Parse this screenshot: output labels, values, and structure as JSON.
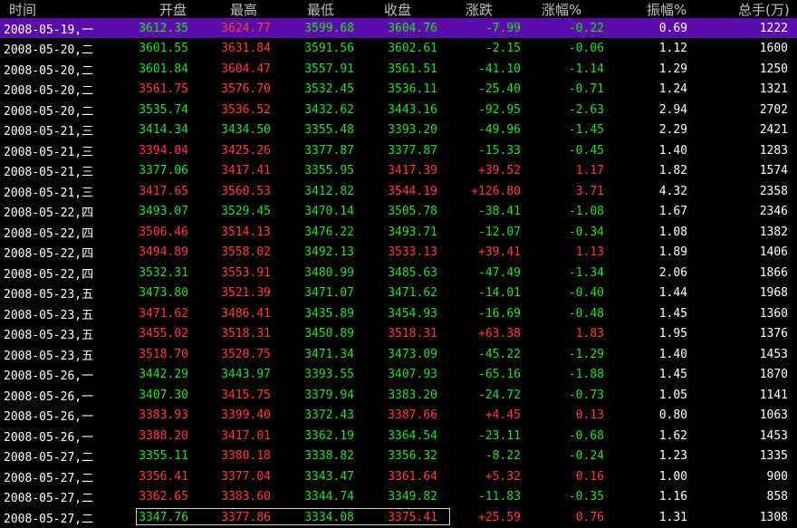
{
  "colors": {
    "up": "#ff3b3b",
    "down": "#22dd22",
    "neutral": "#ffffff",
    "header": "#c0c0c0",
    "selected_bg": "#5a0da8"
  },
  "header": [
    "时间",
    "开盘",
    "最高",
    "最低",
    "收盘",
    "涨跌",
    "涨幅%",
    "振幅%",
    "总手(万)"
  ],
  "rows": [
    {
      "time": "2008-05-19,一",
      "open": "3612.35",
      "high": "3624.77",
      "low": "3599.68",
      "close": "3604.76",
      "chg": "-7.99",
      "pct": "-0.22",
      "amp": "0.69",
      "vol": "1222",
      "c": [
        "down",
        "up",
        "down",
        "down",
        "down",
        "down",
        "neutral",
        "neutral"
      ]
    },
    {
      "time": "2008-05-20,二",
      "open": "3601.55",
      "high": "3631.84",
      "low": "3591.56",
      "close": "3602.61",
      "chg": "-2.15",
      "pct": "-0.06",
      "amp": "1.12",
      "vol": "1600",
      "c": [
        "down",
        "up",
        "down",
        "down",
        "down",
        "down",
        "neutral",
        "neutral"
      ]
    },
    {
      "time": "2008-05-20,二",
      "open": "3601.84",
      "high": "3604.47",
      "low": "3557.91",
      "close": "3561.51",
      "chg": "-41.10",
      "pct": "-1.14",
      "amp": "1.29",
      "vol": "1250",
      "c": [
        "down",
        "up",
        "down",
        "down",
        "down",
        "down",
        "neutral",
        "neutral"
      ]
    },
    {
      "time": "2008-05-20,二",
      "open": "3561.75",
      "high": "3576.70",
      "low": "3532.45",
      "close": "3536.11",
      "chg": "-25.40",
      "pct": "-0.71",
      "amp": "1.24",
      "vol": "1321",
      "c": [
        "up",
        "up",
        "down",
        "down",
        "down",
        "down",
        "neutral",
        "neutral"
      ]
    },
    {
      "time": "2008-05-20,二",
      "open": "3535.74",
      "high": "3536.52",
      "low": "3432.62",
      "close": "3443.16",
      "chg": "-92.95",
      "pct": "-2.63",
      "amp": "2.94",
      "vol": "2702",
      "c": [
        "down",
        "up",
        "down",
        "down",
        "down",
        "down",
        "neutral",
        "neutral"
      ]
    },
    {
      "time": "2008-05-21,三",
      "open": "3414.34",
      "high": "3434.50",
      "low": "3355.48",
      "close": "3393.20",
      "chg": "-49.96",
      "pct": "-1.45",
      "amp": "2.29",
      "vol": "2421",
      "c": [
        "down",
        "down",
        "down",
        "down",
        "down",
        "down",
        "neutral",
        "neutral"
      ]
    },
    {
      "time": "2008-05-21,三",
      "open": "3394.04",
      "high": "3425.26",
      "low": "3377.87",
      "close": "3377.87",
      "chg": "-15.33",
      "pct": "-0.45",
      "amp": "1.40",
      "vol": "1283",
      "c": [
        "up",
        "up",
        "down",
        "down",
        "down",
        "down",
        "neutral",
        "neutral"
      ]
    },
    {
      "time": "2008-05-21,三",
      "open": "3377.06",
      "high": "3417.41",
      "low": "3355.95",
      "close": "3417.39",
      "chg": "+39.52",
      "pct": "1.17",
      "amp": "1.82",
      "vol": "1574",
      "c": [
        "down",
        "up",
        "down",
        "up",
        "up",
        "up",
        "neutral",
        "neutral"
      ]
    },
    {
      "time": "2008-05-21,三",
      "open": "3417.65",
      "high": "3560.53",
      "low": "3412.82",
      "close": "3544.19",
      "chg": "+126.80",
      "pct": "3.71",
      "amp": "4.32",
      "vol": "2358",
      "c": [
        "up",
        "up",
        "down",
        "up",
        "up",
        "up",
        "neutral",
        "neutral"
      ]
    },
    {
      "time": "2008-05-22,四",
      "open": "3493.07",
      "high": "3529.45",
      "low": "3470.14",
      "close": "3505.78",
      "chg": "-38.41",
      "pct": "-1.08",
      "amp": "1.67",
      "vol": "2346",
      "c": [
        "down",
        "down",
        "down",
        "down",
        "down",
        "down",
        "neutral",
        "neutral"
      ]
    },
    {
      "time": "2008-05-22,四",
      "open": "3506.46",
      "high": "3514.13",
      "low": "3476.22",
      "close": "3493.71",
      "chg": "-12.07",
      "pct": "-0.34",
      "amp": "1.08",
      "vol": "1382",
      "c": [
        "up",
        "up",
        "down",
        "down",
        "down",
        "down",
        "neutral",
        "neutral"
      ]
    },
    {
      "time": "2008-05-22,四",
      "open": "3494.89",
      "high": "3558.02",
      "low": "3492.13",
      "close": "3533.13",
      "chg": "+39.41",
      "pct": "1.13",
      "amp": "1.89",
      "vol": "1406",
      "c": [
        "up",
        "up",
        "down",
        "up",
        "up",
        "up",
        "neutral",
        "neutral"
      ]
    },
    {
      "time": "2008-05-22,四",
      "open": "3532.31",
      "high": "3553.91",
      "low": "3480.99",
      "close": "3485.63",
      "chg": "-47.49",
      "pct": "-1.34",
      "amp": "2.06",
      "vol": "1866",
      "c": [
        "down",
        "up",
        "down",
        "down",
        "down",
        "down",
        "neutral",
        "neutral"
      ]
    },
    {
      "time": "2008-05-23,五",
      "open": "3473.80",
      "high": "3521.39",
      "low": "3471.07",
      "close": "3471.62",
      "chg": "-14.01",
      "pct": "-0.40",
      "amp": "1.44",
      "vol": "1968",
      "c": [
        "down",
        "up",
        "down",
        "down",
        "down",
        "down",
        "neutral",
        "neutral"
      ]
    },
    {
      "time": "2008-05-23,五",
      "open": "3471.62",
      "high": "3486.41",
      "low": "3435.89",
      "close": "3454.93",
      "chg": "-16.69",
      "pct": "-0.48",
      "amp": "1.45",
      "vol": "1360",
      "c": [
        "up",
        "up",
        "down",
        "down",
        "down",
        "down",
        "neutral",
        "neutral"
      ]
    },
    {
      "time": "2008-05-23,五",
      "open": "3455.02",
      "high": "3518.31",
      "low": "3450.89",
      "close": "3518.31",
      "chg": "+63.38",
      "pct": "1.83",
      "amp": "1.95",
      "vol": "1376",
      "c": [
        "up",
        "up",
        "down",
        "up",
        "up",
        "up",
        "neutral",
        "neutral"
      ]
    },
    {
      "time": "2008-05-23,五",
      "open": "3518.70",
      "high": "3520.75",
      "low": "3471.34",
      "close": "3473.09",
      "chg": "-45.22",
      "pct": "-1.29",
      "amp": "1.40",
      "vol": "1453",
      "c": [
        "up",
        "up",
        "down",
        "down",
        "down",
        "down",
        "neutral",
        "neutral"
      ]
    },
    {
      "time": "2008-05-26,一",
      "open": "3442.29",
      "high": "3443.97",
      "low": "3393.55",
      "close": "3407.93",
      "chg": "-65.16",
      "pct": "-1.88",
      "amp": "1.45",
      "vol": "1870",
      "c": [
        "down",
        "down",
        "down",
        "down",
        "down",
        "down",
        "neutral",
        "neutral"
      ]
    },
    {
      "time": "2008-05-26,一",
      "open": "3407.30",
      "high": "3415.75",
      "low": "3379.94",
      "close": "3383.20",
      "chg": "-24.72",
      "pct": "-0.73",
      "amp": "1.05",
      "vol": "1141",
      "c": [
        "down",
        "up",
        "down",
        "down",
        "down",
        "down",
        "neutral",
        "neutral"
      ]
    },
    {
      "time": "2008-05-26,一",
      "open": "3383.93",
      "high": "3399.40",
      "low": "3372.43",
      "close": "3387.66",
      "chg": "+4.45",
      "pct": "0.13",
      "amp": "0.80",
      "vol": "1063",
      "c": [
        "up",
        "up",
        "down",
        "up",
        "up",
        "up",
        "neutral",
        "neutral"
      ]
    },
    {
      "time": "2008-05-26,一",
      "open": "3388.20",
      "high": "3417.01",
      "low": "3362.19",
      "close": "3364.54",
      "chg": "-23.11",
      "pct": "-0.68",
      "amp": "1.62",
      "vol": "1453",
      "c": [
        "up",
        "up",
        "down",
        "down",
        "down",
        "down",
        "neutral",
        "neutral"
      ]
    },
    {
      "time": "2008-05-27,二",
      "open": "3355.11",
      "high": "3380.18",
      "low": "3338.82",
      "close": "3356.32",
      "chg": "-8.22",
      "pct": "-0.24",
      "amp": "1.23",
      "vol": "1335",
      "c": [
        "down",
        "up",
        "down",
        "down",
        "down",
        "down",
        "neutral",
        "neutral"
      ]
    },
    {
      "time": "2008-05-27,二",
      "open": "3356.41",
      "high": "3377.04",
      "low": "3343.47",
      "close": "3361.64",
      "chg": "+5.32",
      "pct": "0.16",
      "amp": "1.00",
      "vol": "900",
      "c": [
        "up",
        "up",
        "down",
        "up",
        "up",
        "up",
        "neutral",
        "neutral"
      ]
    },
    {
      "time": "2008-05-27,二",
      "open": "3362.65",
      "high": "3383.60",
      "low": "3344.74",
      "close": "3349.82",
      "chg": "-11.83",
      "pct": "-0.35",
      "amp": "1.16",
      "vol": "858",
      "c": [
        "up",
        "up",
        "down",
        "down",
        "down",
        "down",
        "neutral",
        "neutral"
      ]
    },
    {
      "time": "2008-05-27,二",
      "open": "3347.76",
      "high": "3377.86",
      "low": "3334.08",
      "close": "3375.41",
      "chg": "+25.59",
      "pct": "0.76",
      "amp": "1.31",
      "vol": "1308",
      "c": [
        "down",
        "up",
        "down",
        "up",
        "up",
        "up",
        "neutral",
        "neutral"
      ]
    }
  ]
}
